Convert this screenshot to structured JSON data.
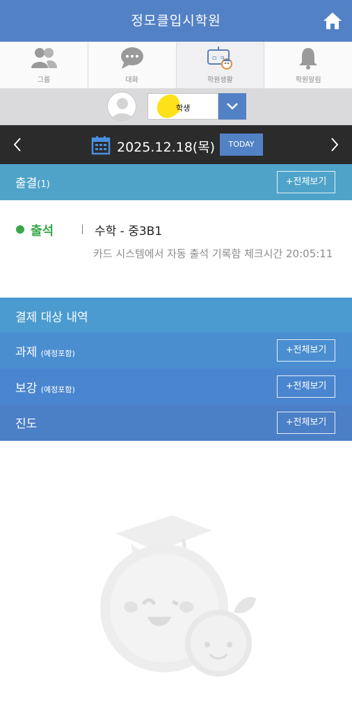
{
  "header": {
    "title": "정모클입시학원",
    "home_icon": "home-icon"
  },
  "tabs": [
    {
      "label": "그룹",
      "icon": "group-icon"
    },
    {
      "label": "대화",
      "icon": "chat-icon"
    },
    {
      "label": "학원생활",
      "icon": "academy-life-icon",
      "active": true
    },
    {
      "label": "학원알림",
      "icon": "bell-icon"
    }
  ],
  "profile": {
    "student_name": "학생",
    "dropdown_icon": "chevron-down-icon"
  },
  "datebar": {
    "date": "2025.12.18(목)",
    "today_label": "TODAY"
  },
  "attendance_section": {
    "label": "출결",
    "count": "(1)",
    "view_all": "+전체보기"
  },
  "attendance_item": {
    "status": "출석",
    "class": "수학 - 중3B1",
    "message": "카드 시스템에서 자동 출석 기록함 체크시간 20:05:11"
  },
  "payment_section": {
    "label": "결제 대상 내역"
  },
  "homework_section": {
    "label": "과제",
    "note": "(예정포함)",
    "view_all": "+전체보기"
  },
  "makeup_section": {
    "label": "보강",
    "note": "(예정포함)",
    "view_all": "+전체보기"
  },
  "progress_section": {
    "label": "진도",
    "view_all": "+전체보기"
  },
  "colors": {
    "primary": "#5381c5",
    "attendance_bar": "#4fa3c9",
    "payment_bar": "#4b9bd0",
    "homework_bar": "#4a8ed0",
    "makeup_bar": "#4a86cf",
    "progress_bar": "#4b7fc6",
    "present_green": "#3aa84a",
    "datebar_bg": "#2b2b2b"
  }
}
